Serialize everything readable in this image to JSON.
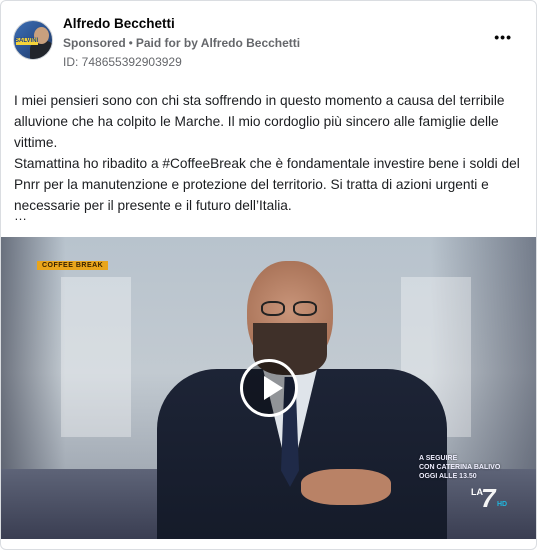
{
  "post": {
    "author": "Alfredo Becchetti",
    "sponsored": "Sponsored",
    "separator": "•",
    "paid_for_by": "Paid for by Alfredo Becchetti",
    "ad_id": "ID: 748655392903929",
    "more_icon": "more-options-icon",
    "avatar_text": "SALVINI",
    "body_lines": [
      "I miei pensieri sono con chi sta soffrendo in questo momento a causa del terribile alluvione che ha colpito le Marche. Il mio cordoglio più sincero alle famiglie delle vittime.",
      "Stamattina ho ribadito a #CoffeeBreak che è fondamentale investire bene i soldi del Pnrr per la manutenzione e protezione del territorio. Si tratta di azioni urgenti e necessarie per il presente e il futuro dell’Italia."
    ],
    "ellipsis": "…"
  },
  "video": {
    "program_tag": "COFFEE BREAK",
    "promo_lines": [
      "A SEGUIRE",
      "CON CATERINA BALIVO",
      "OGGI ALLE 13.50"
    ],
    "channel_prefix": "LA",
    "channel_number": "7",
    "channel_hd": "HD",
    "play_icon": "play-icon"
  },
  "colors": {
    "meta_gray": "#65676b",
    "text": "#1c1e21",
    "border": "#dadde1",
    "program_tag_bg": "#e9a51b"
  }
}
